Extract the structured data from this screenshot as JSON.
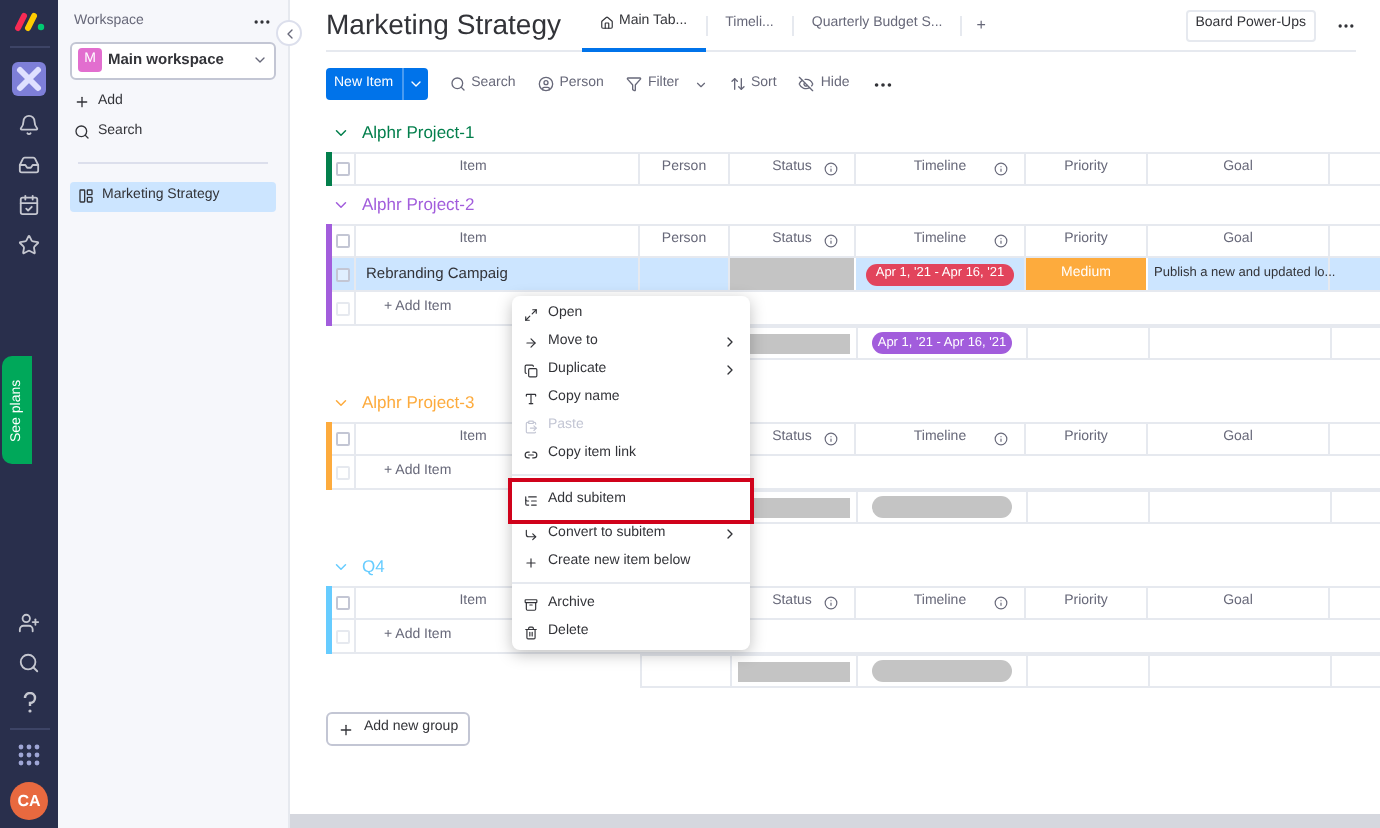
{
  "rail": {
    "see_plans": "See plans",
    "avatar": "CA"
  },
  "sidebar": {
    "heading": "Workspace",
    "workspace_initial": "M",
    "workspace": "Main workspace",
    "actions": [
      {
        "label": "Add"
      },
      {
        "label": "Search"
      }
    ],
    "boards": [
      {
        "label": "Marketing Strategy",
        "selected": true
      }
    ]
  },
  "board": {
    "title": "Marketing Strategy",
    "tabs": [
      {
        "label": "Main Tab...",
        "selected": true
      },
      {
        "label": "Timeli...",
        "selected": false
      },
      {
        "label": "Quarterly Budget S...",
        "selected": false
      }
    ],
    "add_tab": "+",
    "power_ups": "Board Power-Ups"
  },
  "toolbar": {
    "new_item": "New Item",
    "actions": [
      {
        "kind": "search",
        "label": "Search"
      },
      {
        "kind": "person",
        "label": "Person"
      },
      {
        "kind": "filter",
        "label": "Filter"
      },
      {
        "kind": "sort",
        "label": "Sort"
      },
      {
        "kind": "hide",
        "label": "Hide"
      }
    ]
  },
  "groups": [
    {
      "name": "Alphr Project-1",
      "color": "#037f4c",
      "header_checked": false,
      "columns": [
        {
          "kind": "item",
          "label": "Item"
        },
        {
          "kind": "person",
          "label": "Person"
        },
        {
          "kind": "status",
          "label": "Status"
        },
        {
          "kind": "timeline",
          "label": "Timeline"
        },
        {
          "kind": "priority",
          "label": "Priority"
        },
        {
          "kind": "goal",
          "label": "Goal"
        }
      ]
    },
    {
      "name": "Alphr Project-2",
      "color": "#a25ddc",
      "header_checked": false,
      "add_item_checked": false,
      "columns": [
        {
          "kind": "item",
          "label": "Item"
        },
        {
          "kind": "person",
          "label": "Person"
        },
        {
          "kind": "status",
          "label": "Status"
        },
        {
          "kind": "timeline",
          "label": "Timeline"
        },
        {
          "kind": "priority",
          "label": "Priority"
        },
        {
          "kind": "goal",
          "label": "Goal"
        }
      ],
      "items": [
        {
          "name": "Rebranding Campaig",
          "selected": true,
          "checked": false,
          "timeline": {
            "text": "Apr 1, '21 - Apr 16, '21",
            "color": "#e2445c"
          },
          "priority": {
            "text": "Medium",
            "color": "#fdab3d"
          },
          "goal": "Publish a new and updated lo..."
        }
      ],
      "add_item": "+ Add Item",
      "summary": {
        "timeline": {
          "text": "Apr 1, '21 - Apr 16, '21",
          "color": "#a25ddc"
        }
      }
    },
    {
      "name": "Alphr Project-3",
      "color": "#fdab3d",
      "header_checked": false,
      "add_item_checked": false,
      "columns": [
        {
          "kind": "item",
          "label": "Item"
        },
        {
          "kind": "person"
        },
        {
          "kind": "status",
          "label": "Status"
        },
        {
          "kind": "timeline",
          "label": "Timeline"
        },
        {
          "kind": "priority",
          "label": "Priority"
        },
        {
          "kind": "goal",
          "label": "Goal"
        }
      ],
      "add_item": "+ Add Item",
      "summary": {
        "timeline": {
          "color": "#c4c4c4"
        }
      }
    },
    {
      "name": "Q4",
      "color": "#66ccff",
      "header_checked": false,
      "add_item_checked": false,
      "columns": [
        {
          "kind": "item",
          "label": "Item"
        },
        {
          "kind": "person"
        },
        {
          "kind": "status",
          "label": "Status"
        },
        {
          "kind": "timeline",
          "label": "Timeline"
        },
        {
          "kind": "priority",
          "label": "Priority"
        },
        {
          "kind": "goal",
          "label": "Goal"
        }
      ],
      "add_item": "+ Add Item",
      "summary": {
        "timeline": {
          "color": "#c4c4c4"
        }
      }
    }
  ],
  "add_group": "Add new group",
  "context_menu": {
    "sections": [
      [
        {
          "label": "Open",
          "submenu": false,
          "disabled": false,
          "highlighted": false
        },
        {
          "label": "Move to",
          "submenu": true,
          "disabled": false,
          "highlighted": false
        },
        {
          "label": "Duplicate",
          "submenu": true,
          "disabled": false,
          "highlighted": false
        },
        {
          "label": "Copy name",
          "submenu": false,
          "disabled": false,
          "highlighted": false
        },
        {
          "label": "Paste",
          "submenu": false,
          "disabled": true,
          "highlighted": false
        },
        {
          "label": "Copy item link",
          "submenu": false,
          "disabled": false,
          "highlighted": false
        }
      ],
      [
        {
          "label": "Add subitem",
          "submenu": false,
          "disabled": false,
          "highlighted": true
        },
        {
          "label": "Convert to subitem",
          "submenu": true,
          "disabled": false,
          "highlighted": false
        },
        {
          "label": "Create new item below",
          "submenu": false,
          "disabled": false,
          "highlighted": false
        }
      ],
      [
        {
          "label": "Archive",
          "submenu": false,
          "disabled": false,
          "highlighted": false
        },
        {
          "label": "Delete",
          "submenu": false,
          "disabled": false,
          "highlighted": false
        }
      ]
    ]
  }
}
